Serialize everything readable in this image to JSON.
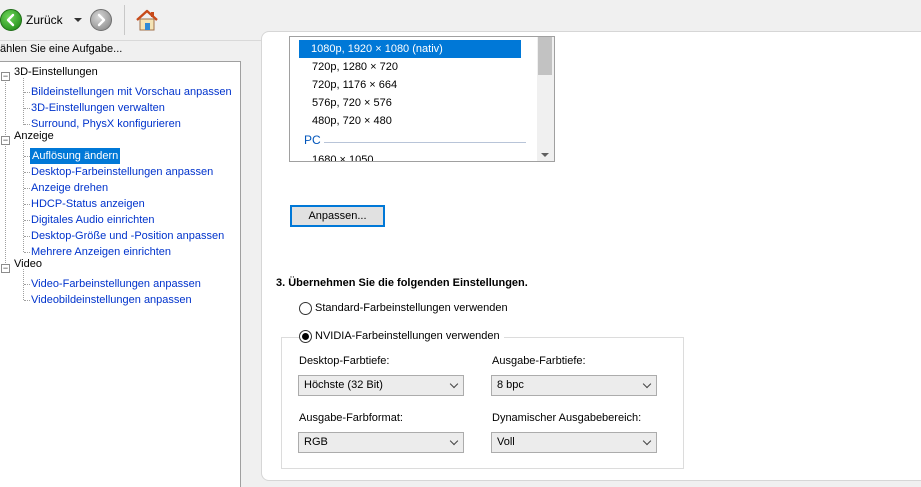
{
  "toolbar": {
    "back_label": "Zurück"
  },
  "sidebar": {
    "task_header": "ählen Sie eine Aufgabe...",
    "groups": [
      {
        "label": "3D-Einstellungen",
        "items": [
          {
            "label": "Bildeinstellungen mit Vorschau anpassen"
          },
          {
            "label": "3D-Einstellungen verwalten"
          },
          {
            "label": "Surround, PhysX konfigurieren"
          }
        ]
      },
      {
        "label": "Anzeige",
        "items": [
          {
            "label": "Auflösung ändern",
            "selected": true
          },
          {
            "label": "Desktop-Farbeinstellungen anpassen"
          },
          {
            "label": "Anzeige drehen"
          },
          {
            "label": "HDCP-Status anzeigen"
          },
          {
            "label": "Digitales Audio einrichten"
          },
          {
            "label": "Desktop-Größe und -Position anpassen"
          },
          {
            "label": "Mehrere Anzeigen einrichten"
          }
        ]
      },
      {
        "label": "Video",
        "items": [
          {
            "label": "Video-Farbeinstellungen anpassen"
          },
          {
            "label": "Videobildeinstellungen anpassen"
          }
        ]
      }
    ]
  },
  "resolution": {
    "items": [
      {
        "label": "1080p, 1920 × 1080 (nativ)",
        "selected": true
      },
      {
        "label": "720p, 1280 × 720"
      },
      {
        "label": "720p, 1176 × 664"
      },
      {
        "label": "576p, 720 × 576"
      },
      {
        "label": "480p, 720 × 480"
      }
    ],
    "group_pc": "PC",
    "partial_item": "1680 × 1050",
    "customize_button": "Anpassen..."
  },
  "settings": {
    "section_title": "3. Übernehmen Sie die folgenden Einstellungen.",
    "radio_standard": "Standard-Farbeinstellungen verwenden",
    "radio_nvidia": "NVIDIA-Farbeinstellungen verwenden",
    "selected_radio": "nvidia",
    "desktop_depth_label": "Desktop-Farbtiefe:",
    "desktop_depth_value": "Höchste (32 Bit)",
    "output_depth_label": "Ausgabe-Farbtiefe:",
    "output_depth_value": "8 bpc",
    "output_format_label": "Ausgabe-Farbformat:",
    "output_format_value": "RGB",
    "dynamic_range_label": "Dynamischer Ausgabebereich:",
    "dynamic_range_value": "Voll"
  },
  "colors": {
    "selection": "#0078d7",
    "link": "#0033cc",
    "group_header": "#0055bb"
  }
}
